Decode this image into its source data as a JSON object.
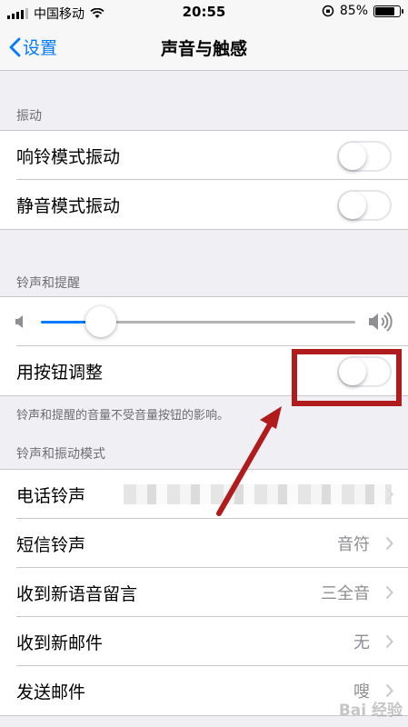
{
  "status_bar": {
    "carrier": "中国移动",
    "time": "20:55",
    "battery": "85%",
    "battery_level": 0.85
  },
  "nav": {
    "back_label": "设置",
    "title": "声音与触感"
  },
  "sections": {
    "vibration": {
      "header": "振动",
      "items": [
        {
          "label": "响铃模式振动",
          "on": false
        },
        {
          "label": "静音模式振动",
          "on": false
        }
      ]
    },
    "ringer": {
      "header": "铃声和提醒",
      "volume_level": 0.19,
      "change_with_buttons": {
        "label": "用按钮调整",
        "on": false
      },
      "footer": "铃声和提醒的音量不受音量按钮的影响。"
    },
    "patterns": {
      "header": "铃声和振动模式",
      "items": [
        {
          "label": "电话铃声",
          "value": ""
        },
        {
          "label": "短信铃声",
          "value": "音符"
        },
        {
          "label": "收到新语音留言",
          "value": "三全音"
        },
        {
          "label": "收到新邮件",
          "value": "无"
        },
        {
          "label": "发送邮件",
          "value": "嗖"
        }
      ]
    }
  },
  "colors": {
    "accent": "#007aff",
    "annotation": "#b01c1c"
  },
  "watermark": "Bai 经验"
}
